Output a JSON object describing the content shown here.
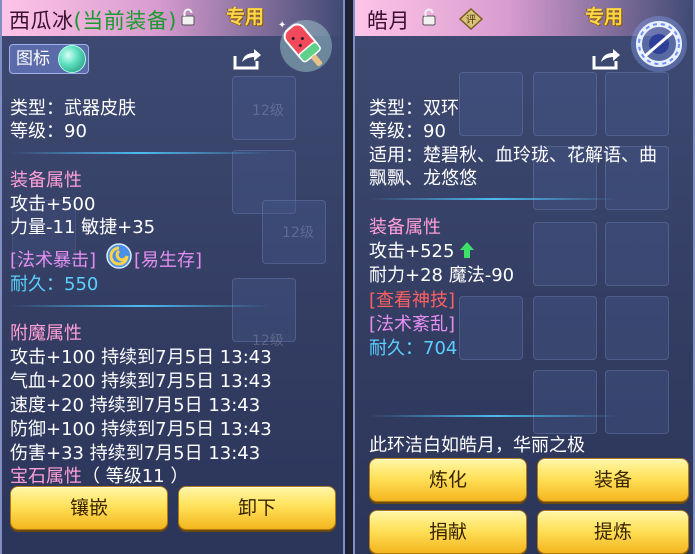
{
  "left": {
    "title": "西瓜冰",
    "equipped": "(当前装备)",
    "exclusive": "专用",
    "tag_label": "图标",
    "type_line": "类型：武器皮肤",
    "level_line": "等级：90",
    "section_equip": "装备属性",
    "attr1": "攻击+500",
    "attr2": "力量-11 敏捷+35",
    "skill1": "[法术暴击]",
    "skill2": "[易生存]",
    "dur_label": "耐久：",
    "dur_value": "550",
    "section_enchant": "附魔属性",
    "enchants": [
      "攻击+100 持续到7月5日 13:43",
      "气血+200 持续到7月5日 13:43",
      "速度+20 持续到7月5日 13:43",
      "防御+100 持续到7月5日 13:43",
      "伤害+33 持续到7月5日 13:43"
    ],
    "section_gem": "宝石属性",
    "gem_level": "（ 等级11 ）",
    "btn_inlay": "镶嵌",
    "btn_unequip": "卸下"
  },
  "right": {
    "title": "皓月",
    "ping": "评",
    "exclusive": "专用",
    "type_line": "类型：双环",
    "level_line": "等级：90",
    "apply_line1": "适用：楚碧秋、血玲珑、花解语、曲",
    "apply_line2": "飘飘、龙悠悠",
    "section_equip": "装备属性",
    "attr1": "攻击+525",
    "attr2": "耐力+28 魔法-90",
    "skill_view": "[查看神技]",
    "skill1": "[法术紊乱]",
    "dur_label": "耐久：",
    "dur_value": "704",
    "desc": "此环洁白如皓月，华丽之极",
    "btn_refine": "炼化",
    "btn_equip": "装备",
    "btn_donate": "捐献",
    "btn_extract": "提炼"
  },
  "colors": {
    "section_title": "#ff9fd7",
    "skill": "#e48ef0",
    "skill_red": "#ff6060",
    "durability": "#5ad0ff",
    "exclusive": "#ffd84a",
    "equipped": "#1b9a2e",
    "button": "#ffe25a"
  },
  "icons": [
    "lock-icon",
    "share-icon",
    "watermelon-ice-weapon-icon",
    "moon-ring-icon",
    "rating-badge-icon",
    "magic-swirl-icon",
    "up-arrow-icon"
  ]
}
